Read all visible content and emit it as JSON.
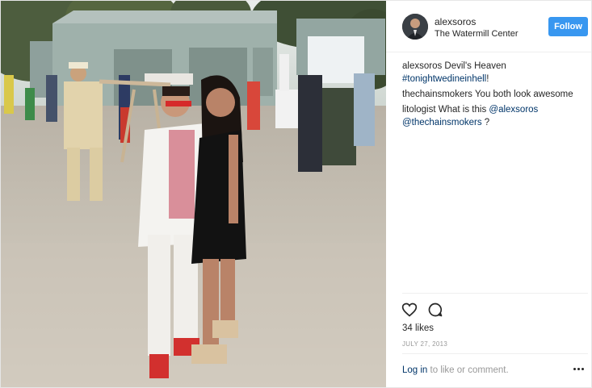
{
  "header": {
    "username": "alexsoros",
    "location": "The Watermill Center",
    "follow_label": "Follow"
  },
  "comments": [
    {
      "user": "alexsoros",
      "text": "Devil's Heaven",
      "tag": "#tonightwedineinhell",
      "tail": "!"
    },
    {
      "user": "thechainsmokers",
      "text": "You both look awesome"
    },
    {
      "user": "litologist",
      "text": "What is this",
      "mention1": "@alexsoros",
      "mention2": "@thechainsmokers",
      "tail": " ?"
    }
  ],
  "actions": {
    "like_icon": "heart-icon",
    "comment_icon": "speech-bubble-icon",
    "likes": "34 likes",
    "date": "JULY 27, 2013"
  },
  "footer": {
    "login_link": "Log in",
    "login_text": " to like or comment.",
    "more_icon": "ellipsis-icon"
  },
  "colors": {
    "follow_button": "#3897f0",
    "link": "#003569",
    "muted": "#999999",
    "text": "#262626"
  }
}
